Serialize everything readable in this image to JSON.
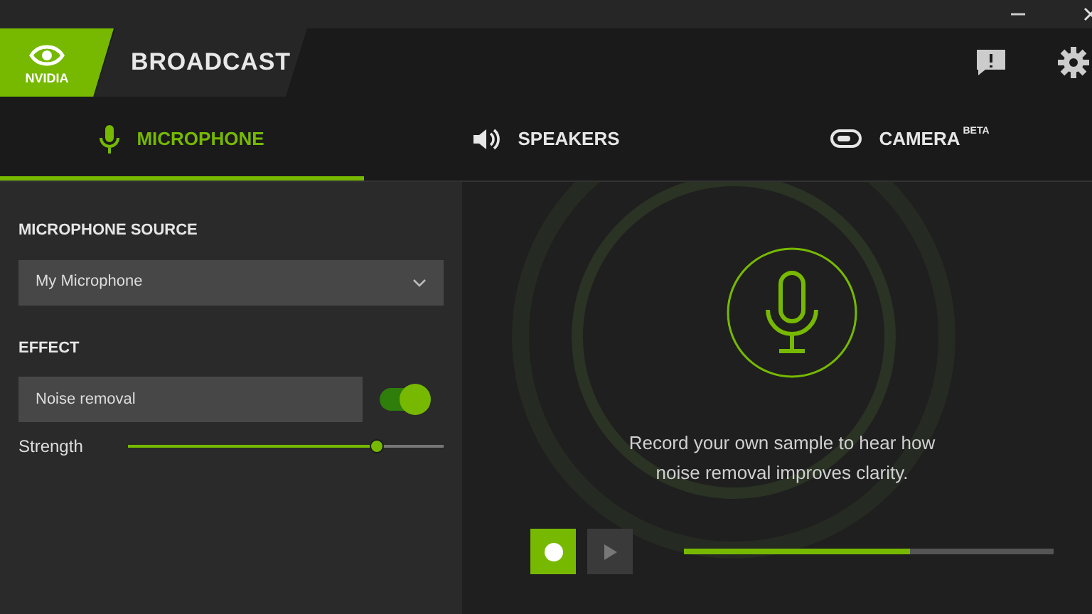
{
  "window": {
    "controls": [
      {
        "kind": "minimize"
      },
      {
        "kind": "close"
      }
    ]
  },
  "header": {
    "logo_text": "NVIDIA",
    "title": "BROADCAST"
  },
  "tabs": [
    {
      "label": "MICROPHONE",
      "kind": "microphone",
      "selected": true
    },
    {
      "label": "SPEAKERS",
      "kind": "speaker",
      "selected": false
    },
    {
      "label": "CAMERA",
      "kind": "camera",
      "badge": "BETA",
      "selected": false
    }
  ],
  "source": {
    "label": "MICROPHONE SOURCE",
    "value": "My Microphone"
  },
  "effect": {
    "label": "EFFECT",
    "value": "Noise removal",
    "on": true,
    "strength_label": "Strength",
    "level": 0.79
  },
  "preview": {
    "message": "Record your own sample to hear how noise removal improves clarity.",
    "recording": true,
    "play_disabled": true,
    "progress": {
      "level": 0.61
    }
  }
}
